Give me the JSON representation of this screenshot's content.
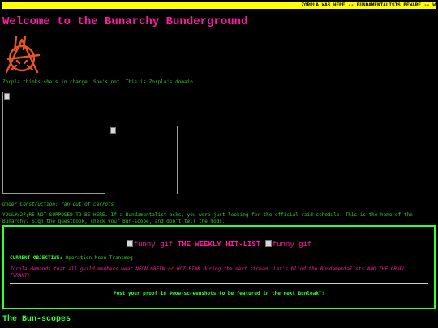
{
  "marquee": {
    "text": "ZORPLA WAS HERE -- BUNDAMENTALISTS BEWARE -- W"
  },
  "header": {
    "title": "Welcome to the Bunarchy Bunderground"
  },
  "logo": {
    "icon": "anarchy-bunny-logo",
    "color": "#e8541e"
  },
  "tagline": "Zorpla thinks she's in charge. She's not. This is Zorpla's domain.",
  "images": {
    "icon": "broken-image-icon"
  },
  "under_construction": "Under Construction: ran out of carrots",
  "notice": "YOU&#x27;RE NOT SUPPOSED TO BE HERE. If a Bundamentalist asks, you were just looking for the official raid schedule. This is the home of the Bunarchy. Sign the guestbook, check your Bun-scope, and don't tell the mods.",
  "hitlist": {
    "gif_alt": "funny gif",
    "title": "THE WEEKLY HIT-LIST",
    "objective_label": "CURRENT OBJECTIVE:",
    "objective_value": "Operation Neon-Transmog",
    "description": "Zorpla demands that all guild members wear NEON GREEN or HOT PINK during the next stream. Let's blind the Bundamentalists AND THE CRUEL TYRANT!",
    "proof": "Post your proof in #wow-screenshots to be featured in the next Bunleak™!"
  },
  "bunscopes": {
    "title": "The Bun-scopes"
  },
  "colors": {
    "pink": "#ff1aa6",
    "green": "#33ff33",
    "yellow": "#ffff00",
    "background": "#000000"
  }
}
